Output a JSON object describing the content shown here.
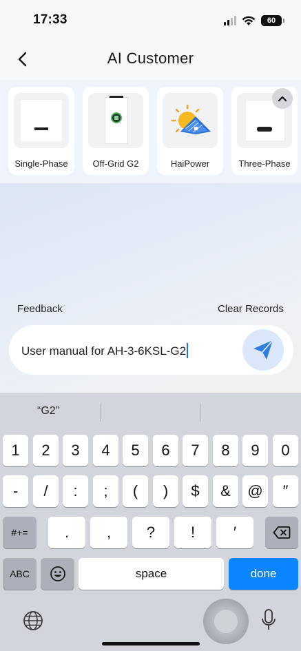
{
  "status_bar": {
    "time": "17:33",
    "battery": "60"
  },
  "header": {
    "title": "AI Customer"
  },
  "products": [
    {
      "label": "Single-Phase"
    },
    {
      "label": "Off-Grid G2"
    },
    {
      "label": "HaiPower"
    },
    {
      "label": "Three-Phase"
    }
  ],
  "actions": {
    "feedback": "Feedback",
    "clear": "Clear Records"
  },
  "chat_input": {
    "value": "User manual for AH-3-6KSL-G2"
  },
  "keyboard": {
    "suggestion": "“G2”",
    "row1": [
      "1",
      "2",
      "3",
      "4",
      "5",
      "6",
      "7",
      "8",
      "9",
      "0"
    ],
    "row2": [
      "-",
      "/",
      ":",
      ";",
      "(",
      ")",
      "$",
      "&",
      "@",
      "″"
    ],
    "row3": [
      ".",
      ",",
      "?",
      "!",
      "′"
    ],
    "symbols_key": "#+=",
    "abc_key": "ABC",
    "space_key": "space",
    "done_key": "done"
  },
  "colors": {
    "accent": "#0a84ff",
    "send_icon": "#2f7de1"
  }
}
